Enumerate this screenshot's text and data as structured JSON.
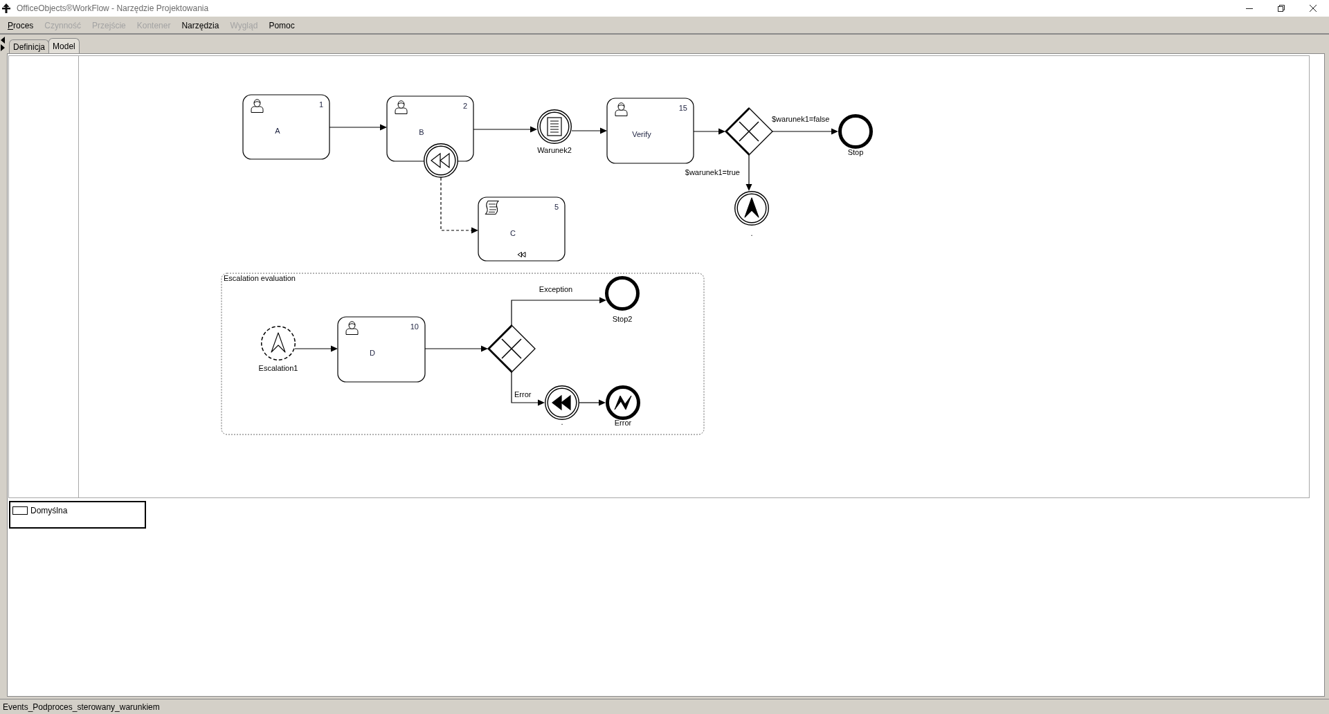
{
  "window": {
    "title": "OfficeObjects®WorkFlow - Narzędzie Projektowania"
  },
  "menu": [
    {
      "label": "Proces",
      "disabled": false,
      "mnemonic": true
    },
    {
      "label": "Czynność",
      "disabled": true,
      "mnemonic": false
    },
    {
      "label": "Przejście",
      "disabled": true,
      "mnemonic": false
    },
    {
      "label": "Kontener",
      "disabled": true,
      "mnemonic": false
    },
    {
      "label": "Narzędzia",
      "disabled": false,
      "mnemonic": false
    },
    {
      "label": "Wygląd",
      "disabled": true,
      "mnemonic": false
    },
    {
      "label": "Pomoc",
      "disabled": false,
      "mnemonic": false
    }
  ],
  "tabs": [
    {
      "label": "Definicja",
      "selected": false
    },
    {
      "label": "Model",
      "selected": true
    }
  ],
  "diagram": {
    "nodes": [
      {
        "kind": "user_task",
        "label": "A",
        "number": "1",
        "compensation": false
      },
      {
        "kind": "user_task",
        "label": "B",
        "number": "2",
        "compensation": false
      },
      {
        "kind": "boundary_event",
        "interrupting": true,
        "trigger": {
          "kind": "compensation",
          "throwing": false
        }
      },
      {
        "kind": "intermediate_event",
        "label": "Warunek2",
        "trigger": {
          "kind": "conditional",
          "throwing": false
        }
      },
      {
        "kind": "user_task",
        "label": "Verify",
        "number": "15",
        "compensation": false
      },
      {
        "kind": "exclusive_gateway"
      },
      {
        "kind": "end_event",
        "label": "Stop"
      },
      {
        "kind": "intermediate_event",
        "label": ".",
        "trigger": {
          "kind": "escalation",
          "throwing": true
        }
      },
      {
        "kind": "script_task",
        "label": "C",
        "number": "5",
        "compensation": true
      }
    ],
    "flows": [
      {
        "kind": "sequence"
      },
      {
        "kind": "sequence"
      },
      {
        "kind": "sequence"
      },
      {
        "kind": "sequence"
      },
      {
        "kind": "sequence",
        "label": "$warunek1=false"
      },
      {
        "kind": "sequence",
        "label": "$warunek1=true"
      },
      {
        "kind": "association"
      }
    ],
    "subprocess": {
      "label": "Escalation evaluation",
      "nodes": [
        {
          "kind": "start_event",
          "interrupting": false,
          "label": "Escalation1",
          "trigger": {
            "kind": "escalation",
            "throwing": false
          }
        },
        {
          "kind": "user_task",
          "label": "D",
          "number": "10",
          "compensation": false
        },
        {
          "kind": "exclusive_gateway"
        },
        {
          "kind": "end_event",
          "label": "Stop2"
        },
        {
          "kind": "intermediate_event",
          "label": ".",
          "trigger": {
            "kind": "compensation",
            "throwing": true
          }
        },
        {
          "kind": "end_event",
          "label": "Error",
          "trigger": {
            "kind": "error",
            "throwing": true
          }
        }
      ],
      "flows": [
        {
          "kind": "sequence"
        },
        {
          "kind": "sequence"
        },
        {
          "kind": "sequence",
          "label": "Exception"
        },
        {
          "kind": "sequence",
          "label": "Error"
        },
        {
          "kind": "sequence"
        }
      ]
    }
  },
  "lanes": [
    {
      "label": "Domyślna"
    }
  ],
  "status_bar": {
    "text": "Events_Podproces_sterowany_warunkiem"
  }
}
